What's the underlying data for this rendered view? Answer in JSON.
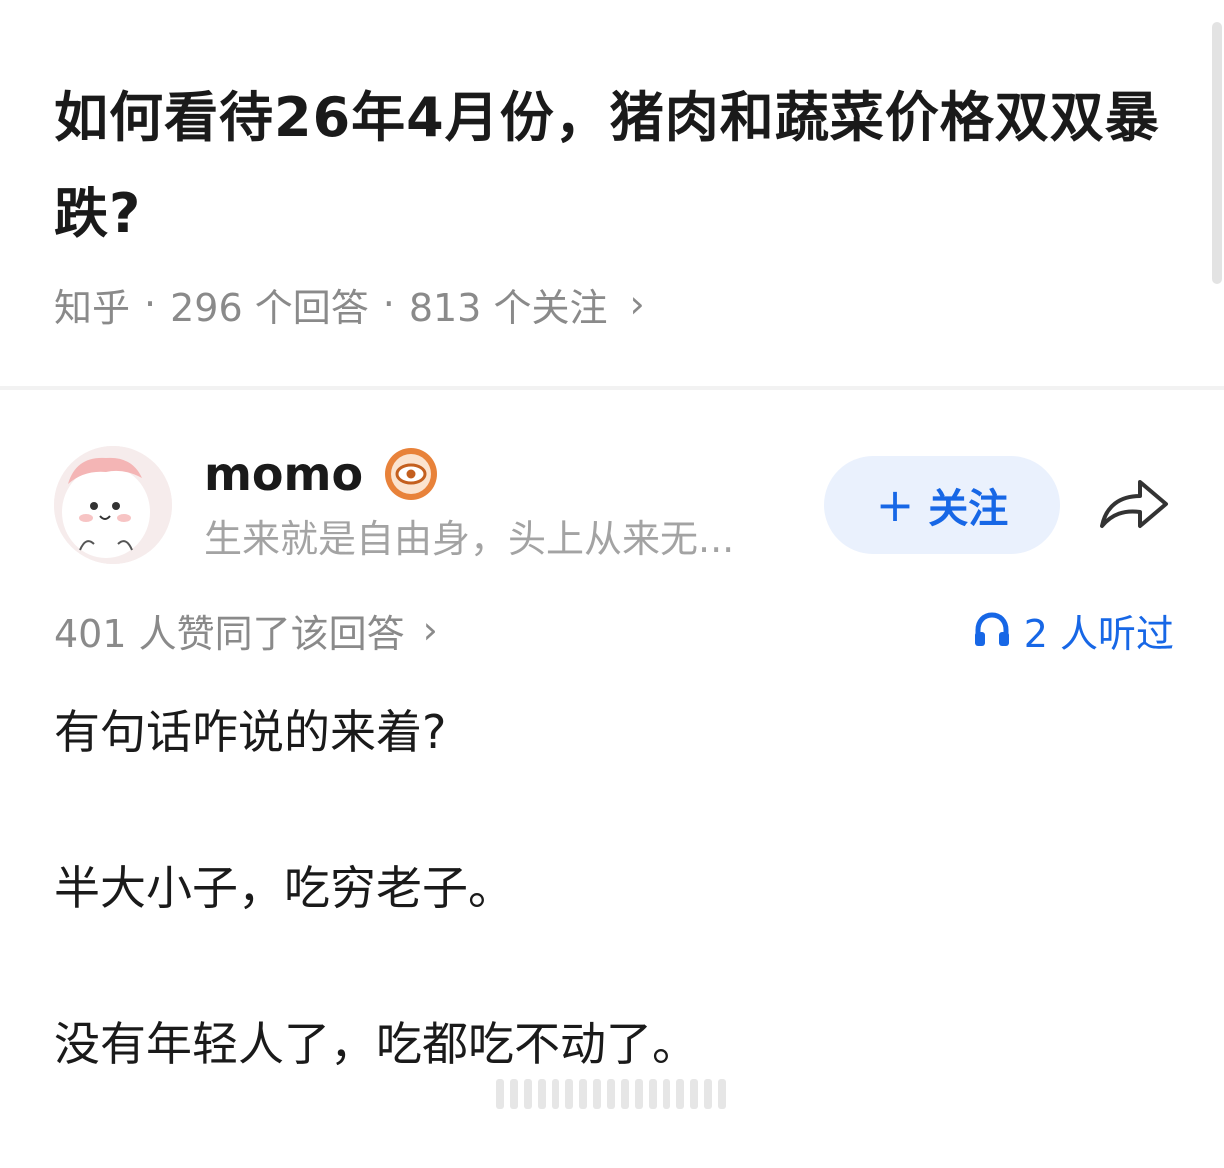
{
  "question": {
    "title": "如何看待26年4月份，猪肉和蔬菜价格双双暴跌?",
    "source": "知乎",
    "separator": "·",
    "answers": "296 个回答",
    "followers": "813 个关注",
    "chevron": "›"
  },
  "answer": {
    "author": {
      "name": "momo",
      "bio": "生来就是自由身，头上从来无...",
      "badge_icon": "eye-badge-icon"
    },
    "follow_label": "关注",
    "follow_plus": "+",
    "upvotes_text": "401 人赞同了该回答",
    "upvotes_chevron": "›",
    "listened_text": "2 人听过",
    "paragraphs": [
      "有句话咋说的来着?",
      "半大小子，吃穷老子。",
      "没有年轻人了，吃都吃不动了。"
    ]
  },
  "colors": {
    "accent": "#1767e6",
    "follow_bg": "#eaf1fd",
    "muted_text": "#8a8a8a",
    "badge": "#e8823a"
  }
}
